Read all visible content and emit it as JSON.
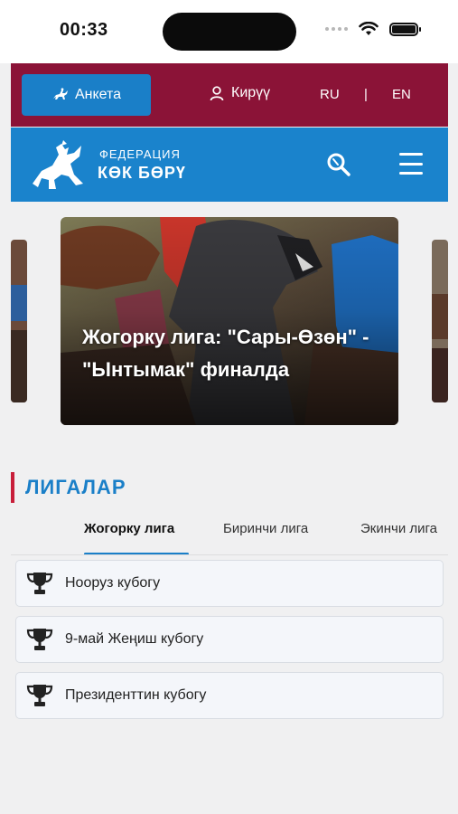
{
  "status": {
    "time": "00:33"
  },
  "top_bar": {
    "anketa_label": "Анкета",
    "login_label": "Кирүү",
    "lang_ru": "RU",
    "lang_sep": "|",
    "lang_en": "EN"
  },
  "brand": {
    "logo_line1": "ФЕДЕРАЦИЯ",
    "logo_line2": "КӨК БӨРҮ"
  },
  "carousel": {
    "slide_title": "Жогорку лига: \"Сары-Өзөн\" - \"Ынтымак\" финалда"
  },
  "leagues": {
    "section_title": "ЛИГАЛАР",
    "tabs": [
      {
        "label": "Жогорку лига"
      },
      {
        "label": "Биринчи лига"
      },
      {
        "label": "Экинчи лига"
      }
    ],
    "active_tab_index": 0,
    "cups": [
      {
        "label": "Нооруз кубогу"
      },
      {
        "label": "9-май Жеңиш кубогу"
      },
      {
        "label": "Президенттин кубогу"
      }
    ]
  },
  "colors": {
    "top_bar": "#8b1337",
    "brand_bar": "#1a83cc",
    "accent_blue": "#1a7fc8",
    "accent_red": "#c81e3a"
  }
}
